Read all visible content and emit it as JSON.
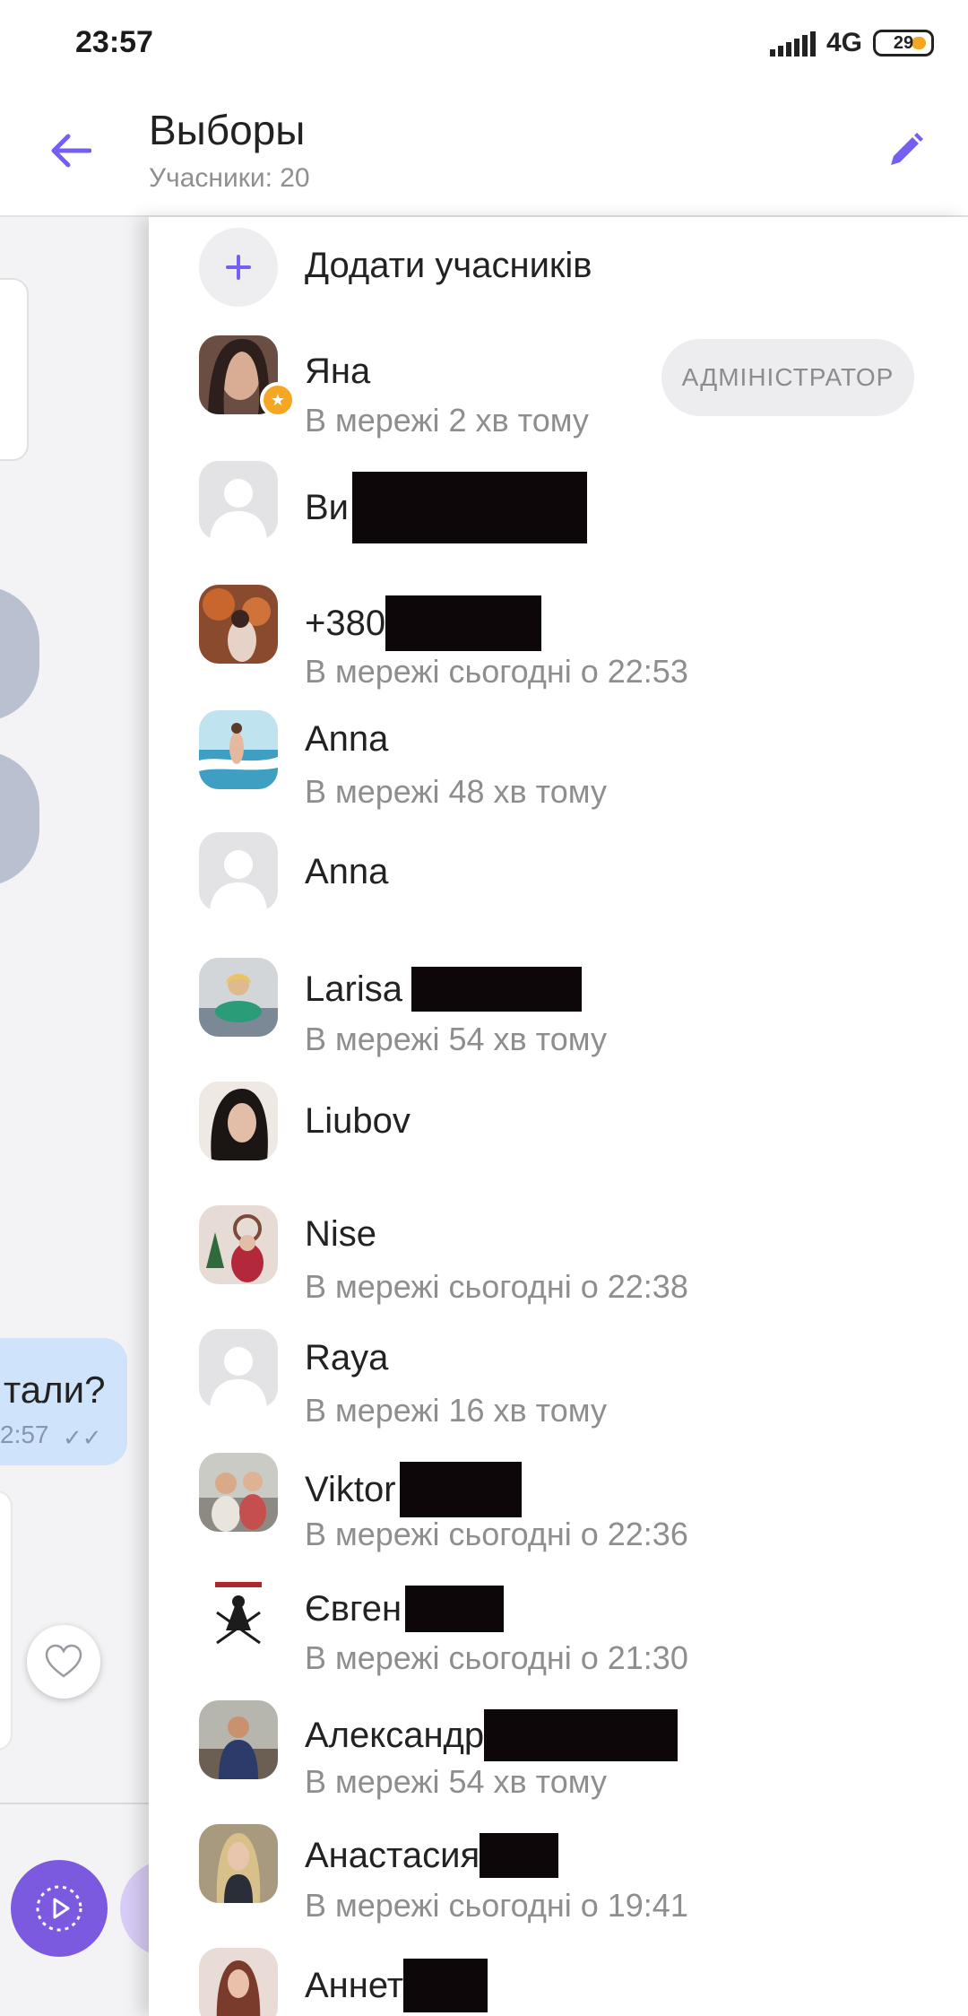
{
  "status_bar": {
    "time": "23:57",
    "network": "4G",
    "battery": "29"
  },
  "header": {
    "title": "Выборы",
    "subtitle": "Учасники: 20",
    "back_icon": "arrow-left-icon",
    "edit_icon": "pencil-icon"
  },
  "background_chat": {
    "bubble_text": "тали?",
    "bubble_time": "2:57"
  },
  "drawer": {
    "add_label": "Додати учасників",
    "admin_badge": "АДМІНІСТРАТОР",
    "members": [
      {
        "name": "Яна",
        "status": "В мережі 2 хв тому"
      },
      {
        "name": "Ви",
        "status": ""
      },
      {
        "name": "+380",
        "status": "В мережі сьогодні о 22:53"
      },
      {
        "name": "Anna",
        "status": "В мережі 48 хв тому"
      },
      {
        "name": "Anna",
        "status": ""
      },
      {
        "name": "Larisa",
        "status": "В мережі 54 хв тому"
      },
      {
        "name": "Liubov",
        "status": ""
      },
      {
        "name": "Nise",
        "status": "В мережі сьогодні о 22:38"
      },
      {
        "name": "Raya",
        "status": "В мережі 16 хв тому"
      },
      {
        "name": "Viktor",
        "status": "В мережі сьогодні о 22:36"
      },
      {
        "name": "Євген",
        "status": "В мережі сьогодні о 21:30"
      },
      {
        "name": "Александр",
        "status": "В мережі 54 хв тому"
      },
      {
        "name": "Анастасия",
        "status": "В мережі сьогодні о 19:41"
      },
      {
        "name": "Аннет",
        "status": ""
      }
    ]
  },
  "colors": {
    "accent": "#7360f2",
    "bubble": "#cfe3fb",
    "admin_star": "#f5a623"
  }
}
